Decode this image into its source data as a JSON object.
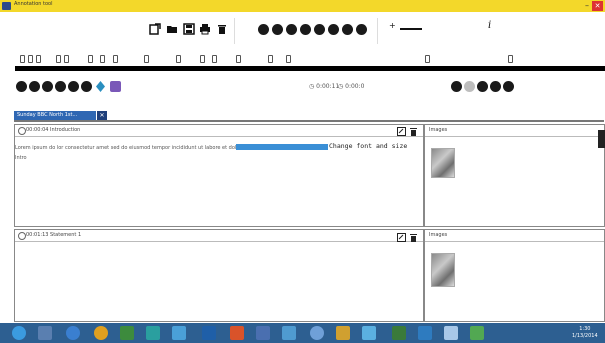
{
  "window": {
    "title": "Annotation tool",
    "minimize": "–",
    "close": "✕"
  },
  "toolbar": {
    "file_icons": [
      "new-document-icon",
      "open-folder-icon",
      "save-icon",
      "print-icon",
      "delete-icon"
    ],
    "round_buttons": 8,
    "zoom_plus": "+",
    "italic_label": "i"
  },
  "navigation": {
    "segment_1": "◷ 0:00:11",
    "segment_2": "◷ 0:00:0",
    "left_buttons": 8,
    "right_buttons": 5
  },
  "document_tab": {
    "label": "Sunday BBC North 1st...",
    "close": "✕"
  },
  "panels": [
    {
      "header": "00:00:04 Introduction",
      "text": "Lorem ipsum do lor consectetur amet sed do eiusmod tempor incididunt ut labore et dolore",
      "selected_text": "",
      "change_font": "Change font and size",
      "text_line2": "Intro",
      "images_header": "Images"
    },
    {
      "header": "00:01:13 Statement 1",
      "text": "",
      "images_header": "Images"
    }
  ],
  "taskbar": {
    "time": "1:30",
    "date": "1/13/2014"
  }
}
